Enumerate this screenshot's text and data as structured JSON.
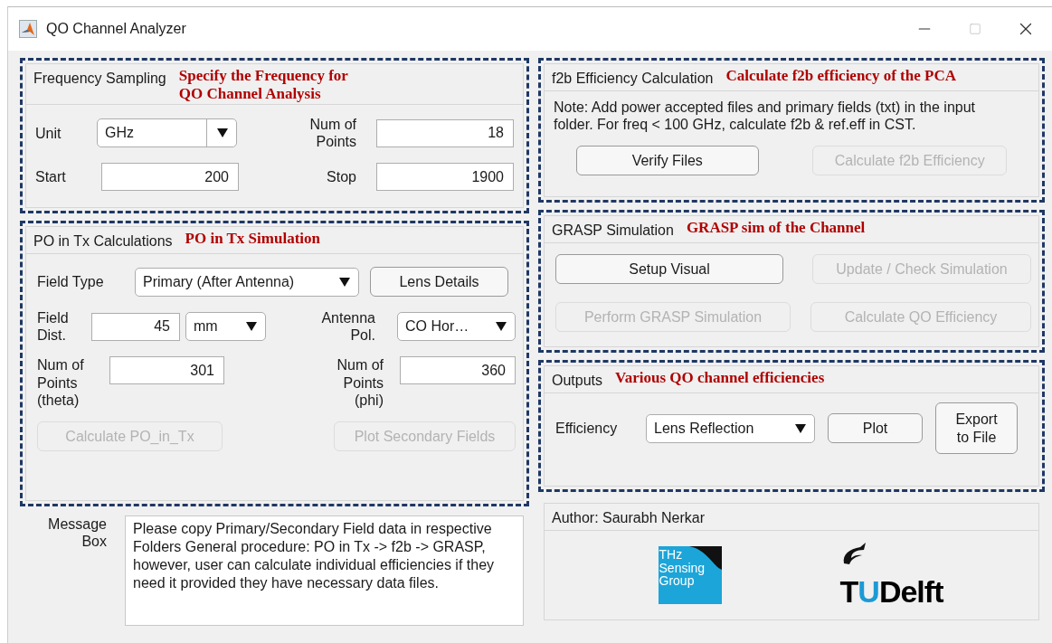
{
  "window": {
    "title": "QO Channel Analyzer"
  },
  "frequency_sampling": {
    "title": "Frequency Sampling",
    "annotation": "Specify the Frequency for\nQO Channel Analysis",
    "unit": {
      "label": "Unit",
      "value": "GHz"
    },
    "num_points": {
      "label": "Num of\nPoints",
      "value": "18"
    },
    "start": {
      "label": "Start",
      "value": "200"
    },
    "stop": {
      "label": "Stop",
      "value": "1900"
    }
  },
  "po_in_tx": {
    "title": "PO in Tx Calculations",
    "annotation": "PO in Tx Simulation",
    "field_type": {
      "label": "Field Type",
      "value": "Primary (After Antenna)"
    },
    "lens_details": {
      "label": "Lens Details",
      "disabled": false
    },
    "field_dist": {
      "label": "Field\nDist.",
      "value": "45",
      "unit": "mm"
    },
    "antenna_pol": {
      "label": "Antenna\nPol.",
      "value": "CO Hor…"
    },
    "points_theta": {
      "label": "Num of\nPoints\n(theta)",
      "value": "301"
    },
    "points_phi": {
      "label": "Num of\nPoints\n(phi)",
      "value": "360"
    },
    "buttons": [
      {
        "label": "Calculate PO_in_Tx",
        "disabled": true
      },
      {
        "label": "Plot Secondary Fields",
        "disabled": true
      }
    ]
  },
  "message": {
    "label": "Message\nBox",
    "text": "Please copy Primary/Secondary Field data in respective Folders General procedure: PO in Tx -> f2b -> GRASP, however, user can calculate individual efficiencies if they need it provided they have necessary data files."
  },
  "f2b": {
    "title": "f2b Efficiency Calculation",
    "annotation": "Calculate f2b efficiency of the PCA",
    "note": "Note: Add power accepted files and primary fields (txt) in the input folder. For freq < 100 GHz, calculate f2b & ref.eff in CST.",
    "buttons": [
      {
        "label": "Verify Files",
        "disabled": false
      },
      {
        "label": "Calculate f2b Efficiency",
        "disabled": true
      }
    ]
  },
  "grasp": {
    "title": "GRASP Simulation",
    "annotation": "GRASP sim of the Channel",
    "buttons": [
      {
        "label": "Setup Visual",
        "disabled": false
      },
      {
        "label": "Update / Check Simulation",
        "disabled": true
      },
      {
        "label": "Perform GRASP Simulation",
        "disabled": true
      },
      {
        "label": "Calculate QO Efficiency",
        "disabled": true
      }
    ]
  },
  "outputs": {
    "title": "Outputs",
    "annotation": "Various QO channel efficiencies",
    "efficiency": {
      "label": "Efficiency",
      "value": "Lens Reflection"
    },
    "buttons": [
      {
        "label": "Plot",
        "disabled": false
      },
      {
        "label": "Export\nto File",
        "disabled": false
      }
    ]
  },
  "author": {
    "title": "Author: Saurabh Nerkar",
    "thz_logo": {
      "text": "THz\nSensing\nGroup"
    },
    "tu_logo": {
      "parts": [
        {
          "text": "T",
          "color": "#000000"
        },
        {
          "text": "U",
          "color": "#1c9ad6"
        },
        {
          "text": "Delft",
          "color": "#000000"
        }
      ]
    }
  }
}
